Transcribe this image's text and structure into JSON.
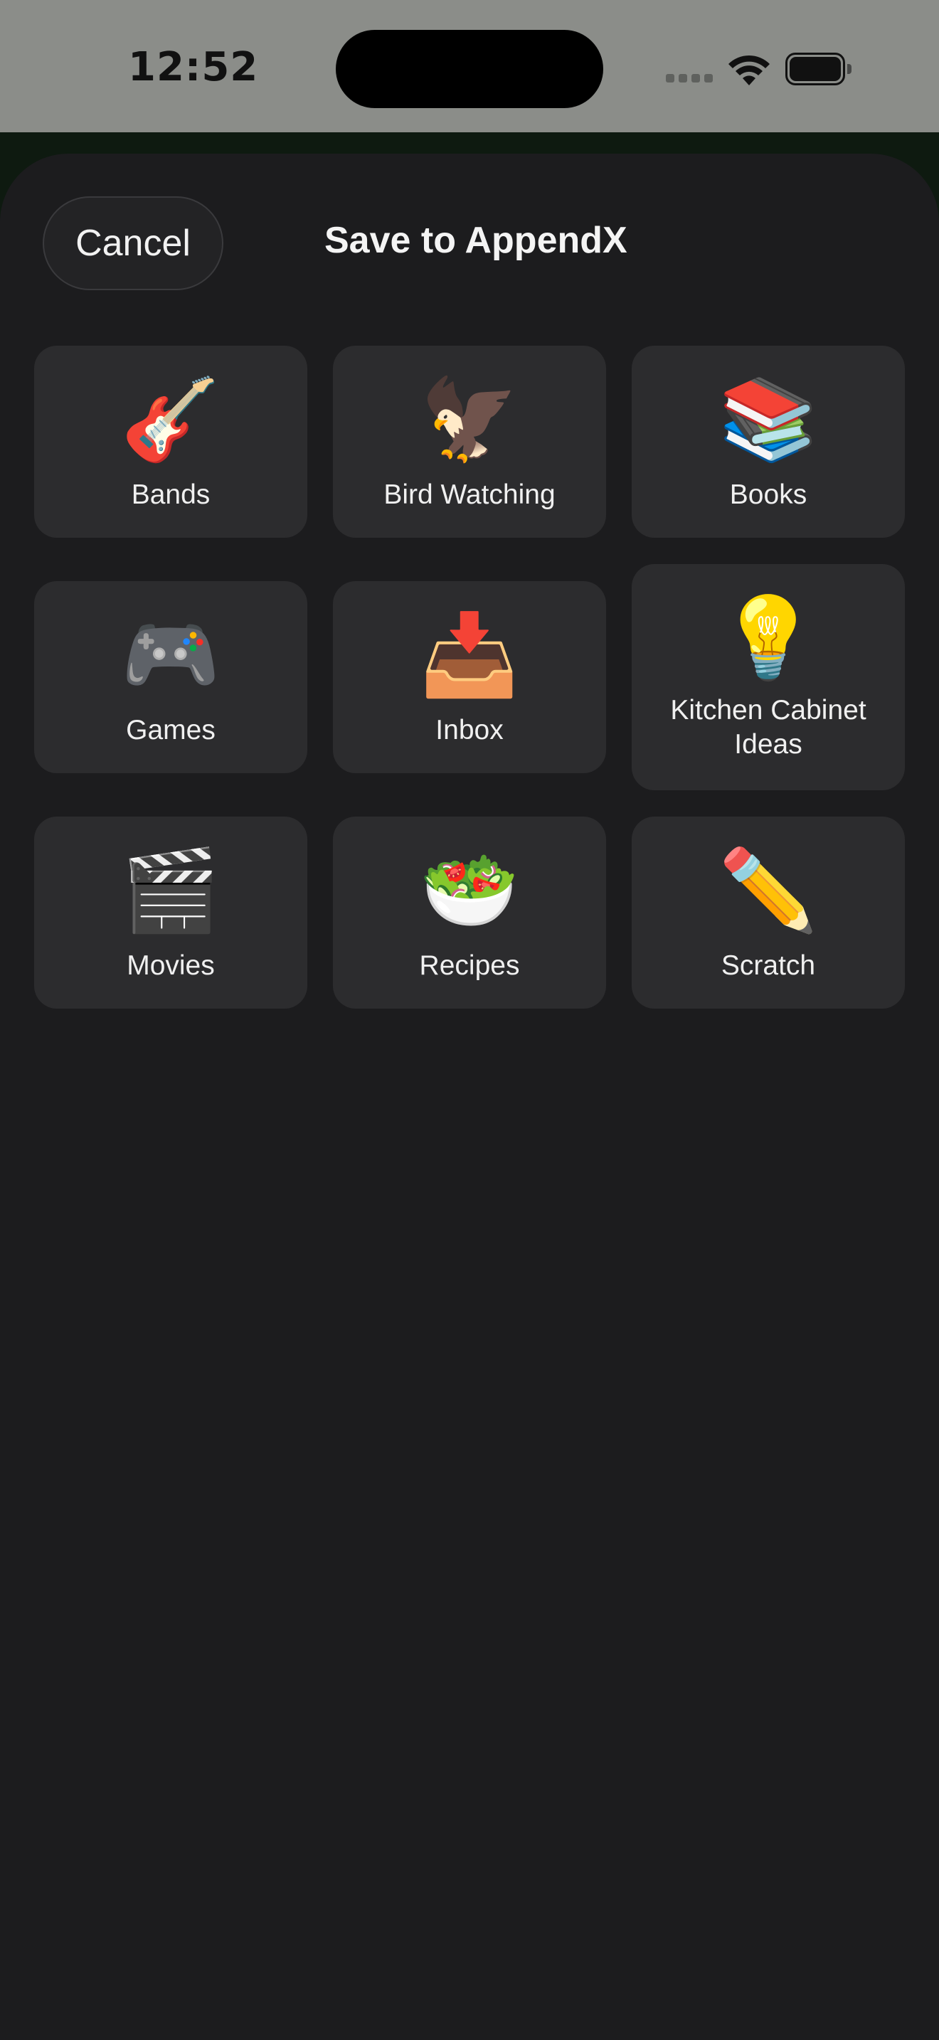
{
  "status_bar": {
    "time": "12:52",
    "icons": [
      "cellular-signal-icon",
      "wifi-icon",
      "battery-icon"
    ]
  },
  "sheet": {
    "cancel_label": "Cancel",
    "title": "Save to AppendX"
  },
  "collections": [
    {
      "label": "Bands",
      "icon": "🎸",
      "icon_name": "guitar-icon"
    },
    {
      "label": "Bird Watching",
      "icon": "🦅",
      "icon_name": "eagle-icon"
    },
    {
      "label": "Books",
      "icon": "📚",
      "icon_name": "books-icon"
    },
    {
      "label": "Games",
      "icon": "🎮",
      "icon_name": "game-controller-icon"
    },
    {
      "label": "Inbox",
      "icon": "📥",
      "icon_name": "inbox-tray-icon"
    },
    {
      "label": "Kitchen Cabinet Ideas",
      "icon": "💡",
      "icon_name": "light-bulb-icon"
    },
    {
      "label": "Movies",
      "icon": "🎬",
      "icon_name": "clapper-board-icon"
    },
    {
      "label": "Recipes",
      "icon": "🥗",
      "icon_name": "salad-icon"
    },
    {
      "label": "Scratch",
      "icon": "✏️",
      "icon_name": "pencil-icon"
    }
  ],
  "colors": {
    "status_bar_bg": "#8b8d89",
    "sheet_bg": "#1c1c1e",
    "tile_bg": "#2c2c2e",
    "text": "#f0f0f0"
  }
}
